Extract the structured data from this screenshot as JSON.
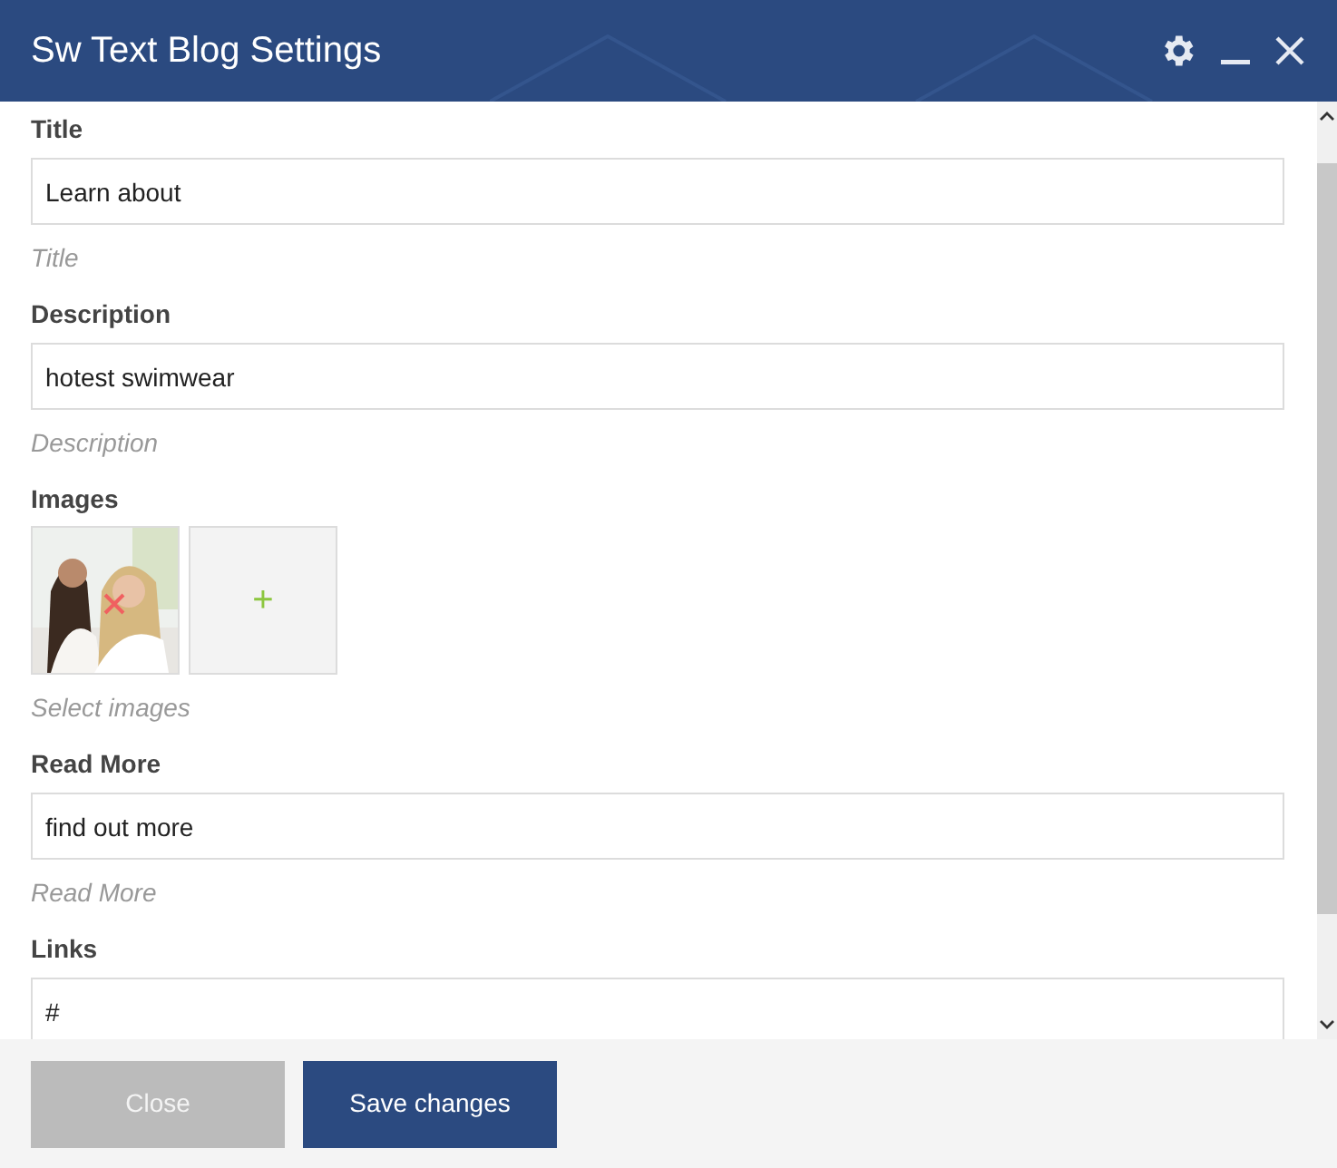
{
  "window": {
    "title": "Sw Text Blog Settings"
  },
  "fields": [
    {
      "kind": "text",
      "label": "Title",
      "value": "Learn about",
      "hint": "Title"
    },
    {
      "kind": "text",
      "label": "Description",
      "value": "hotest swimwear",
      "hint": "Description"
    },
    {
      "kind": "images",
      "label": "Images",
      "add_button": "+",
      "hint": "Select images"
    },
    {
      "kind": "text",
      "label": "Read More",
      "value": "find out more",
      "hint": "Read More"
    },
    {
      "kind": "text",
      "label": "Links",
      "value": "#"
    }
  ],
  "buttons": [
    {
      "kind": "secondary",
      "label": "Close"
    },
    {
      "kind": "primary",
      "label": "Save changes"
    }
  ]
}
